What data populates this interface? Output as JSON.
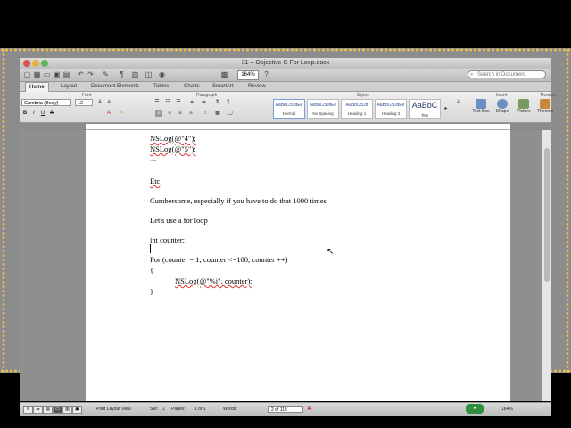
{
  "window": {
    "title": "31 – Objective C For Loop.docx"
  },
  "toolbar": {
    "zoom_value": "164%",
    "search_placeholder": "Search in Document"
  },
  "ribbon_tabs": [
    "Home",
    "Layout",
    "Document Elements",
    "Tables",
    "Charts",
    "SmartArt",
    "Review"
  ],
  "ribbon": {
    "font_group_label": "Font",
    "paragraph_group_label": "Paragraph",
    "styles_group_label": "Styles",
    "insert_group_label": "Insert",
    "themes_group_label": "Themes",
    "font_name": "Cambria (Body)",
    "font_size": "12",
    "styles": [
      {
        "sample": "AaBbCcDdEe",
        "name": "Normal"
      },
      {
        "sample": "AaBbCcDdEe",
        "name": "No Spacing"
      },
      {
        "sample": "AaBbCcDd",
        "name": "Heading 1"
      },
      {
        "sample": "AaBbCcDdEe",
        "name": "Heading 2"
      },
      {
        "sample": "AaBbC",
        "name": "Title"
      }
    ],
    "insert_items": [
      "Text Box",
      "Shape",
      "Picture",
      "Themes"
    ]
  },
  "document": {
    "lines": [
      "NSLog(@\"4\");",
      "NSLog(@\"5\");",
      ".....",
      "",
      "Etc",
      "",
      "Cumbersome, especially if you have to do that 1000 times",
      "",
      "Let's use a for loop",
      "",
      "int counter;",
      "",
      "For (counter = 1; counter <=100; counter ++)",
      "{",
      "NSLog(@\"%i\", counter);",
      "}"
    ]
  },
  "status": {
    "view_label": "Print Layout View",
    "sec_label": "Sec",
    "sec_value": "1",
    "pages_label": "Pages:",
    "pages_value": "1 of 1",
    "words_label": "Words:",
    "words_value": "2 of 113",
    "zoom_value": "164%"
  }
}
